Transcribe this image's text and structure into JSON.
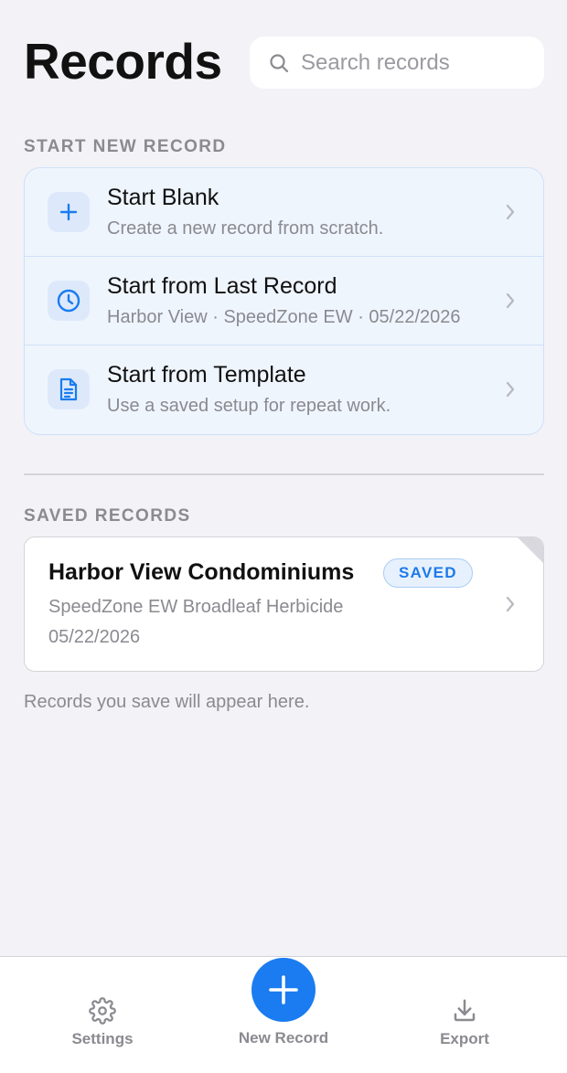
{
  "header": {
    "title": "Records",
    "search_placeholder": "Search records"
  },
  "start_section": {
    "label": "START NEW RECORD",
    "items": [
      {
        "title": "Start Blank",
        "subtitle": "Create a new record from scratch.",
        "icon": "plus-icon"
      },
      {
        "title": "Start from Last Record",
        "subtitle": "Harbor View · SpeedZone EW · 05/22/2026",
        "icon": "clock-icon"
      },
      {
        "title": "Start from Template",
        "subtitle": "Use a saved setup for repeat work.",
        "icon": "document-icon"
      }
    ]
  },
  "saved_section": {
    "label": "SAVED RECORDS",
    "records": [
      {
        "title": "Harbor View Condominiums",
        "badge": "SAVED",
        "product": "SpeedZone EW Broadleaf Herbicide",
        "date": "05/22/2026"
      }
    ],
    "hint": "Records you save will appear here."
  },
  "tabbar": {
    "settings_label": "Settings",
    "new_record_label": "New Record",
    "export_label": "Export"
  },
  "colors": {
    "accent": "#1a7cf0",
    "background": "#f2f2f7",
    "muted_text": "#8a8a90",
    "card_tint": "#eff5fd"
  }
}
